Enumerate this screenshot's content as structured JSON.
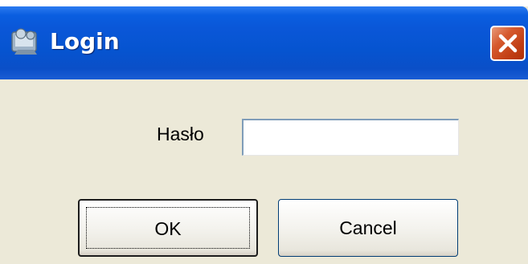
{
  "window": {
    "title": "Login",
    "icon": "login-app-icon",
    "close_icon": "close-icon"
  },
  "form": {
    "password_label": "Hasło",
    "password_value": "",
    "password_placeholder": ""
  },
  "buttons": {
    "ok_label": "OK",
    "cancel_label": "Cancel"
  },
  "colors": {
    "titlebar": "#0a5ee0",
    "close_button": "#d65a2e",
    "client_background": "#ece9d8"
  }
}
